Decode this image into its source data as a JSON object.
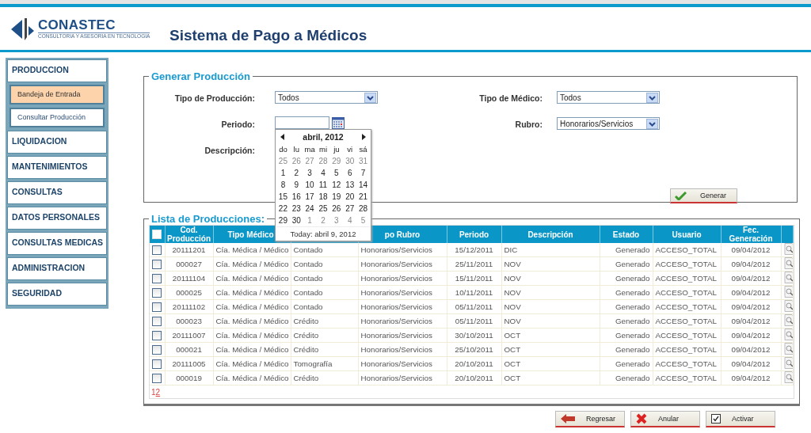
{
  "header": {
    "logo": "CONASTEC",
    "tagline": "CONSULTORIA Y ASESORIA EN TECNOLOGIA",
    "title": "Sistema de Pago a Médicos"
  },
  "sidebar": {
    "items": [
      {
        "label": "PRODUCCION",
        "children": [
          {
            "label": "Bandeja de Entrada",
            "selected": true
          },
          {
            "label": "Consultar Producción",
            "selected": false
          }
        ]
      },
      {
        "label": "LIQUIDACION"
      },
      {
        "label": "MANTENIMIENTOS"
      },
      {
        "label": "CONSULTAS"
      },
      {
        "label": "DATOS PERSONALES"
      },
      {
        "label": "CONSULTAS MEDICAS"
      },
      {
        "label": "ADMINISTRACION"
      },
      {
        "label": "SEGURIDAD"
      }
    ]
  },
  "generar": {
    "title": "Generar Producción",
    "fields": [
      {
        "label": "Tipo de Producción:",
        "kind": "select",
        "value": "Todos"
      },
      {
        "label": "Tipo de Médico:",
        "kind": "select",
        "value": "Todos"
      },
      {
        "label": "Periodo:",
        "kind": "date"
      },
      {
        "label": "Rubro:",
        "kind": "select",
        "value": "Honorarios/Servicios"
      },
      {
        "label": "Descripción:"
      }
    ],
    "button": "Generar"
  },
  "calendar": {
    "month": "abril, 2012",
    "weekdays": [
      "do",
      "lu",
      "ma",
      "mi",
      "ju",
      "vi",
      "sá"
    ],
    "weeks": [
      [
        {
          "day": "25",
          "other_month": true
        },
        {
          "day": "26",
          "other_month": true
        },
        {
          "day": "27",
          "other_month": true
        },
        {
          "day": "28",
          "other_month": true
        },
        {
          "day": "29",
          "other_month": true
        },
        {
          "day": "30",
          "other_month": true
        },
        {
          "day": "31",
          "other_month": true
        }
      ],
      [
        {
          "day": "1",
          "other_month": false
        },
        {
          "day": "2",
          "other_month": false
        },
        {
          "day": "3",
          "other_month": false
        },
        {
          "day": "4",
          "other_month": false
        },
        {
          "day": "5",
          "other_month": false
        },
        {
          "day": "6",
          "other_month": false
        },
        {
          "day": "7",
          "other_month": false
        }
      ],
      [
        {
          "day": "8",
          "other_month": false
        },
        {
          "day": "9",
          "other_month": false
        },
        {
          "day": "10",
          "other_month": false
        },
        {
          "day": "11",
          "other_month": false
        },
        {
          "day": "12",
          "other_month": false
        },
        {
          "day": "13",
          "other_month": false
        },
        {
          "day": "14",
          "other_month": false
        }
      ],
      [
        {
          "day": "15",
          "other_month": false
        },
        {
          "day": "16",
          "other_month": false
        },
        {
          "day": "17",
          "other_month": false
        },
        {
          "day": "18",
          "other_month": false
        },
        {
          "day": "19",
          "other_month": false
        },
        {
          "day": "20",
          "other_month": false
        },
        {
          "day": "21",
          "other_month": false
        }
      ],
      [
        {
          "day": "22",
          "other_month": false
        },
        {
          "day": "23",
          "other_month": false
        },
        {
          "day": "24",
          "other_month": false
        },
        {
          "day": "25",
          "other_month": false
        },
        {
          "day": "26",
          "other_month": false
        },
        {
          "day": "27",
          "other_month": false
        },
        {
          "day": "28",
          "other_month": false
        }
      ],
      [
        {
          "day": "29",
          "other_month": false
        },
        {
          "day": "30",
          "other_month": false
        },
        {
          "day": "1",
          "other_month": true
        },
        {
          "day": "2",
          "other_month": true
        },
        {
          "day": "3",
          "other_month": true
        },
        {
          "day": "4",
          "other_month": true
        },
        {
          "day": "5",
          "other_month": true
        }
      ]
    ],
    "today": "Today: abril 9, 2012"
  },
  "lista": {
    "title": "Lista de Producciones:",
    "select_all": {
      "checked": false
    },
    "columns": [
      {
        "label": "Cod. Producción"
      },
      {
        "label": "Tipo Médico"
      },
      {},
      {
        "label": "po Rubro"
      },
      {
        "label": "Periodo"
      },
      {
        "label": "Descripción"
      },
      {
        "label": "Estado"
      },
      {
        "label": "Usuario"
      },
      {
        "label": "Fec. Generación"
      }
    ],
    "rows": [
      {
        "checked": false,
        "cells": [
          "20111201",
          "Cía. Médica / Médico",
          "Contado",
          "Honorarios/Servicios",
          "15/12/2011",
          "DIC",
          "Generado",
          "ACCESO_TOTAL",
          "09/04/2012"
        ]
      },
      {
        "checked": false,
        "cells": [
          "000027",
          "Cía. Médica / Médico",
          "Contado",
          "Honorarios/Servicios",
          "25/11/2011",
          "NOV",
          "Generado",
          "ACCESO_TOTAL",
          "09/04/2012"
        ]
      },
      {
        "checked": false,
        "cells": [
          "20111104",
          "Cía. Médica / Médico",
          "Contado",
          "Honorarios/Servicios",
          "15/11/2011",
          "NOV",
          "Generado",
          "ACCESO_TOTAL",
          "09/04/2012"
        ]
      },
      {
        "checked": false,
        "cells": [
          "000025",
          "Cía. Médica / Médico",
          "Contado",
          "Honorarios/Servicios",
          "10/11/2011",
          "NOV",
          "Generado",
          "ACCESO_TOTAL",
          "09/04/2012"
        ]
      },
      {
        "checked": false,
        "cells": [
          "20111102",
          "Cía. Médica / Médico",
          "Contado",
          "Honorarios/Servicios",
          "05/11/2011",
          "NOV",
          "Generado",
          "ACCESO_TOTAL",
          "09/04/2012"
        ]
      },
      {
        "checked": false,
        "cells": [
          "000023",
          "Cía. Médica / Médico",
          "Crédito",
          "Honorarios/Servicios",
          "05/11/2011",
          "NOV",
          "Generado",
          "ACCESO_TOTAL",
          "09/04/2012"
        ]
      },
      {
        "checked": false,
        "cells": [
          "20111007",
          "Cía. Médica / Médico",
          "Crédito",
          "Honorarios/Servicios",
          "30/10/2011",
          "OCT",
          "Generado",
          "ACCESO_TOTAL",
          "09/04/2012"
        ]
      },
      {
        "checked": false,
        "cells": [
          "000021",
          "Cía. Médica / Médico",
          "Crédito",
          "Honorarios/Servicios",
          "25/10/2011",
          "OCT",
          "Generado",
          "ACCESO_TOTAL",
          "09/04/2012"
        ]
      },
      {
        "checked": false,
        "cells": [
          "20111005",
          "Cía. Médica / Médico",
          "Tomografía",
          "Honorarios/Servicios",
          "20/10/2011",
          "OCT",
          "Generado",
          "ACCESO_TOTAL",
          "09/04/2012"
        ]
      },
      {
        "checked": false,
        "cells": [
          "000019",
          "Cía. Médica / Médico",
          "Crédito",
          "Honorarios/Servicios",
          "20/10/2011",
          "OCT",
          "Generado",
          "ACCESO_TOTAL",
          "09/04/2012"
        ]
      }
    ],
    "pages": [
      {
        "label": "1",
        "selected": true
      },
      {
        "label": "2",
        "selected": false
      }
    ]
  },
  "buttons": [
    {
      "label": "Regresar",
      "kind": "back"
    },
    {
      "label": "Anular",
      "kind": "cancel"
    },
    {
      "label": "Activar",
      "kind": "activate"
    }
  ]
}
